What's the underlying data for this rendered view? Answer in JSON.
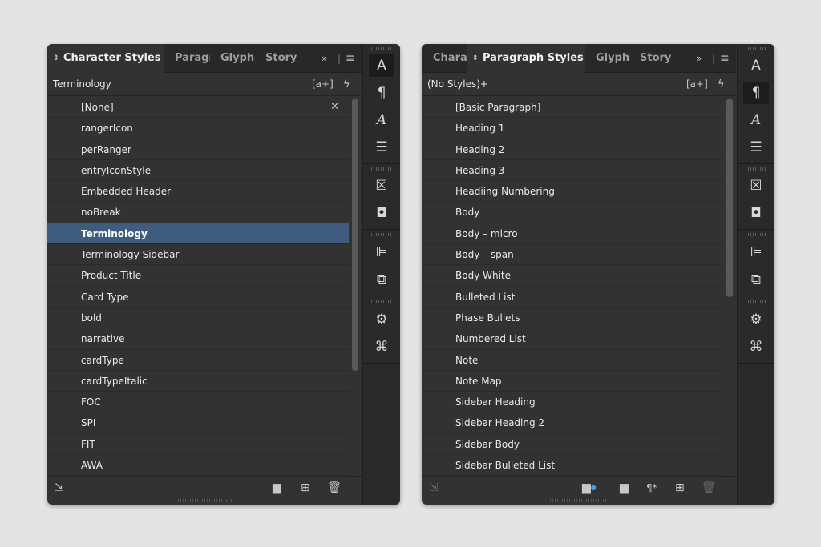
{
  "left_panel": {
    "tabs": {
      "active": "Character Styles",
      "t2": "Paragr",
      "t3": "Glyphs",
      "t4": "Story"
    },
    "toolbar_title": "Terminology",
    "items": [
      "[None]",
      "rangerIcon",
      "perRanger",
      "entryIconStyle",
      "Embedded Header",
      "noBreak",
      "Terminology",
      "Terminology Sidebar",
      "Product Title",
      "Card Type",
      "bold",
      "narrative",
      "cardType",
      "cardTypeItalic",
      "FOC",
      "SPI",
      "FIT",
      "AWA"
    ],
    "selected_item": "Terminology"
  },
  "right_panel": {
    "tabs": {
      "t1": "Chara",
      "active": "Paragraph Styles",
      "t3": "Glyphs",
      "t4": "Story"
    },
    "toolbar_title": "(No Styles)+",
    "items": [
      "[Basic Paragraph]",
      "Heading 1",
      "Heading 2",
      "Heading 3",
      "Headiing Numbering",
      "Body",
      "Body – micro",
      "Body – span",
      "Body White",
      "Bulleted List",
      "Phase Bullets",
      "Numbered List",
      "Note",
      "Note Map",
      "Sidebar Heading",
      "Sidebar Heading 2",
      "Sidebar Body",
      "Sidebar Bulleted List"
    ]
  },
  "glyphs": {
    "chevron": "◇",
    "more": "»",
    "menu": "≡",
    "new_group": "[a+]",
    "lightning": "ϟ",
    "clear_override": "✕",
    "folder": "▬",
    "new": "⊞",
    "trash": "🗑",
    "load": "⇲",
    "char_styles": "A",
    "para_styles": "¶",
    "glyphs_icon": "𝒜",
    "story_icon": "☰",
    "object_styles": "☒",
    "swatches": "◘",
    "align": "⊫",
    "pathfinder": "⧉",
    "links": "⚙",
    "gpu": "⌘",
    "clear_para": "¶*"
  },
  "colors": {
    "accent_selected": "#3f5b7e",
    "panel_bg": "#323232",
    "page_bg": "#e4e4e4"
  }
}
